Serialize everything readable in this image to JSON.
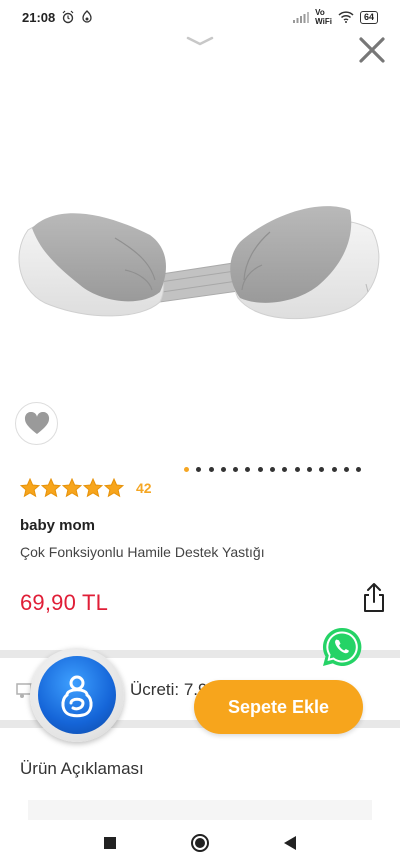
{
  "status_bar": {
    "time": "21:08",
    "network_label_top": "Vo",
    "network_label_bottom": "WiFi",
    "battery": "64"
  },
  "product": {
    "rating_stars": 5,
    "review_count": "42",
    "brand": "baby mom",
    "name": "Çok Fonksiyonlu Hamile Destek Yastığı",
    "price": "69,90 TL",
    "image_dots_total": 15,
    "image_dots_active": 0
  },
  "shipping": {
    "label": "Ücreti:  7.9"
  },
  "actions": {
    "add_to_cart_label": "Sepete Ekle"
  },
  "description": {
    "title": "Ürün Açıklaması"
  },
  "colors": {
    "accent": "#f7a51c",
    "price": "#e01e37",
    "whatsapp": "#25d366",
    "support": "#1565d8"
  },
  "icons": [
    "chevron-down-icon",
    "close-icon",
    "heart-icon",
    "star-icon",
    "share-icon",
    "whatsapp-icon",
    "truck-icon",
    "support-icon",
    "nav-recents-icon",
    "nav-home-icon",
    "nav-back-icon"
  ]
}
